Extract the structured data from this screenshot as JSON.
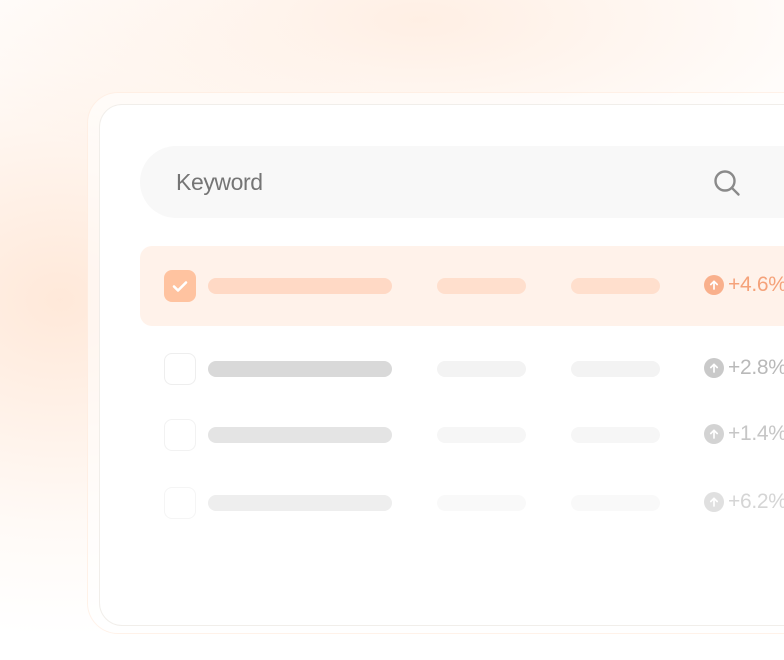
{
  "search": {
    "placeholder": "Keyword",
    "value": ""
  },
  "colors": {
    "accent": "#ffc3a0",
    "accent_text": "#f5a27a",
    "selected_row_bg": "#fff2ea"
  },
  "rows": [
    {
      "checked": true,
      "change": "+4.6%"
    },
    {
      "checked": false,
      "change": "+2.8%"
    },
    {
      "checked": false,
      "change": "+1.4%"
    },
    {
      "checked": false,
      "change": "+6.2%"
    }
  ]
}
